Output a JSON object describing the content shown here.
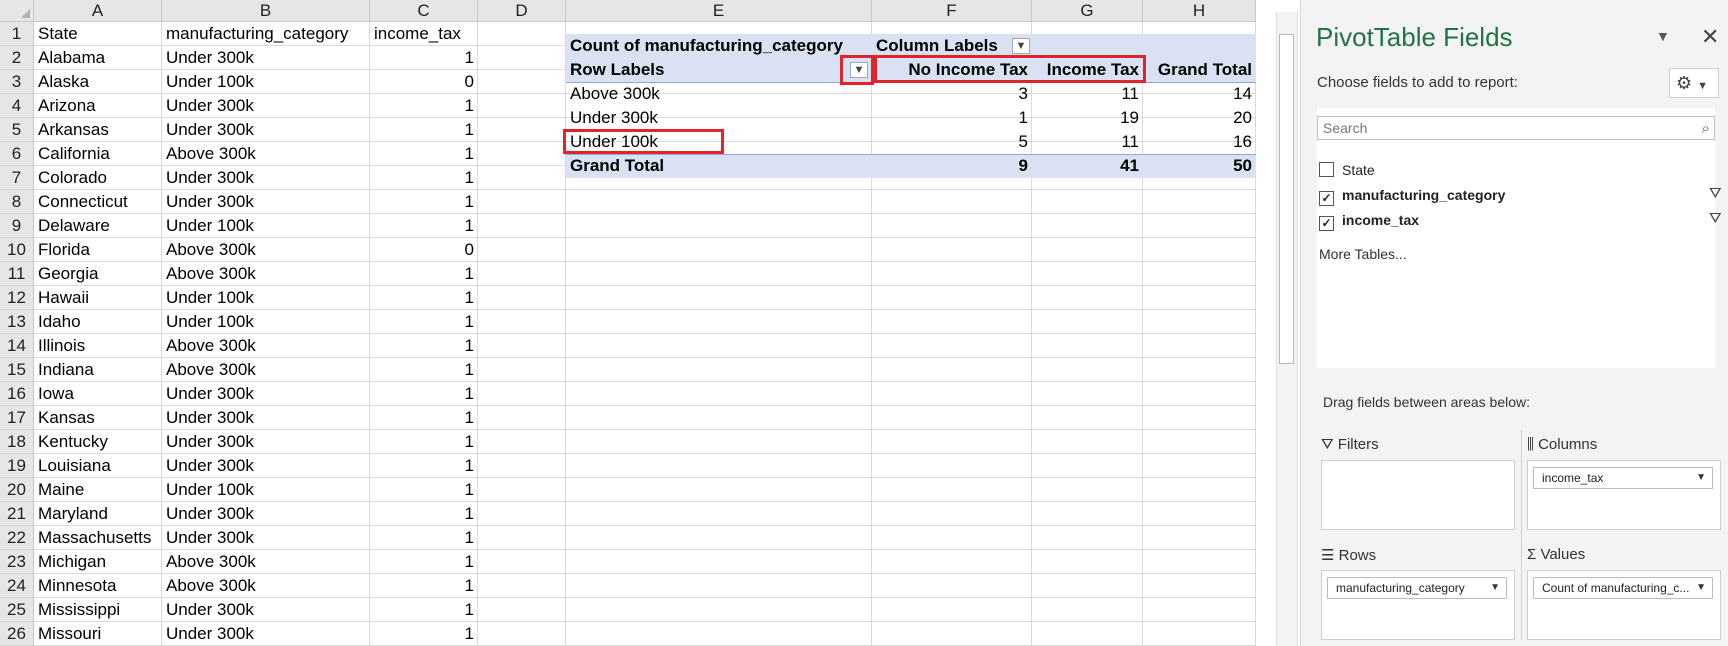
{
  "sheet": {
    "corner_icon": "select-all-triangle",
    "columns": [
      "A",
      "B",
      "C",
      "D",
      "E",
      "F",
      "G",
      "H"
    ],
    "row_numbers": [
      "1",
      "2",
      "3",
      "4",
      "5",
      "6",
      "7",
      "8",
      "9",
      "10",
      "11",
      "12",
      "13",
      "14",
      "15",
      "16",
      "17",
      "18",
      "19",
      "20",
      "21",
      "22",
      "23",
      "24",
      "25",
      "26"
    ],
    "data_headers": {
      "a": "State",
      "b": "manufacturing_category",
      "c": "income_tax"
    },
    "rows": [
      [
        "Alabama",
        "Under 300k",
        "1"
      ],
      [
        "Alaska",
        "Under 100k",
        "0"
      ],
      [
        "Arizona",
        "Under 300k",
        "1"
      ],
      [
        "Arkansas",
        "Under 300k",
        "1"
      ],
      [
        "California",
        "Above 300k",
        "1"
      ],
      [
        "Colorado",
        "Under 300k",
        "1"
      ],
      [
        "Connecticut",
        "Under 300k",
        "1"
      ],
      [
        "Delaware",
        "Under 100k",
        "1"
      ],
      [
        "Florida",
        "Above 300k",
        "0"
      ],
      [
        "Georgia",
        "Above 300k",
        "1"
      ],
      [
        "Hawaii",
        "Under 100k",
        "1"
      ],
      [
        "Idaho",
        "Under 100k",
        "1"
      ],
      [
        "Illinois",
        "Above 300k",
        "1"
      ],
      [
        "Indiana",
        "Above 300k",
        "1"
      ],
      [
        "Iowa",
        "Under 300k",
        "1"
      ],
      [
        "Kansas",
        "Under 300k",
        "1"
      ],
      [
        "Kentucky",
        "Under 300k",
        "1"
      ],
      [
        "Louisiana",
        "Under 300k",
        "1"
      ],
      [
        "Maine",
        "Under 100k",
        "1"
      ],
      [
        "Maryland",
        "Under 300k",
        "1"
      ],
      [
        "Massachusetts",
        "Under 300k",
        "1"
      ],
      [
        "Michigan",
        "Above 300k",
        "1"
      ],
      [
        "Minnesota",
        "Above 300k",
        "1"
      ],
      [
        "Mississippi",
        "Under 300k",
        "1"
      ],
      [
        "Missouri",
        "Under 300k",
        "1"
      ]
    ]
  },
  "pivot": {
    "value_title": "Count of manufacturing_category",
    "column_labels": "Column Labels",
    "row_labels": "Row Labels",
    "col_headers": [
      "No Income Tax",
      "Income Tax",
      "Grand Total"
    ],
    "rows": [
      {
        "label": "Above 300k",
        "values": [
          "3",
          "11",
          "14"
        ]
      },
      {
        "label": "Under 300k",
        "values": [
          "1",
          "19",
          "20"
        ]
      },
      {
        "label": "Under 100k",
        "values": [
          "5",
          "11",
          "16"
        ]
      }
    ],
    "grand_total": {
      "label": "Grand Total",
      "values": [
        "9",
        "41",
        "50"
      ]
    },
    "highlight_color": "#e0242b",
    "header_fill": "#d9e1f2"
  },
  "panel": {
    "title": "PivotTable Fields",
    "subtitle": "Choose fields to add to report:",
    "search_placeholder": "Search",
    "fields": [
      {
        "name": "State",
        "checked": false,
        "filtered": false
      },
      {
        "name": "manufacturing_category",
        "checked": true,
        "filtered": true
      },
      {
        "name": "income_tax",
        "checked": true,
        "filtered": true
      }
    ],
    "more_tables": "More Tables...",
    "drag_hint": "Drag fields between areas below:",
    "areas": {
      "filters": {
        "title": "Filters",
        "items": []
      },
      "columns": {
        "title": "Columns",
        "items": [
          "income_tax"
        ]
      },
      "rows": {
        "title": "Rows",
        "items": [
          "manufacturing_category"
        ]
      },
      "values": {
        "title": "Values",
        "items": [
          "Count of manufacturing_c..."
        ]
      }
    },
    "accent": "#217346"
  }
}
